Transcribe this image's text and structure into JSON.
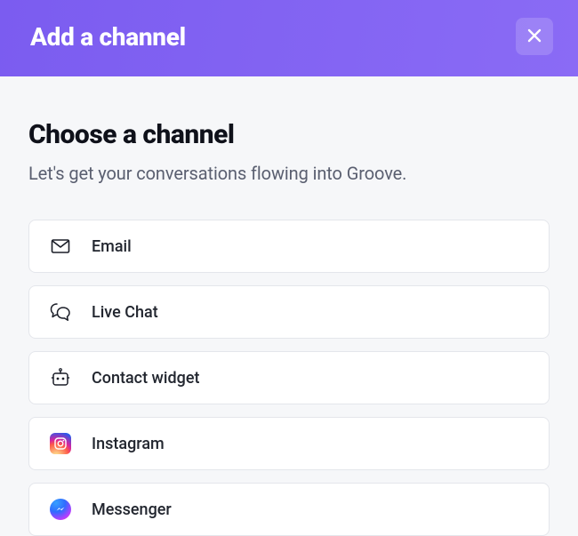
{
  "header": {
    "title": "Add a channel"
  },
  "section": {
    "title": "Choose a channel",
    "subtitle": "Let's get your conversations flowing into Groove."
  },
  "channels": [
    {
      "key": "email",
      "label": "Email",
      "icon": "email-icon"
    },
    {
      "key": "live-chat",
      "label": "Live Chat",
      "icon": "chat-icon"
    },
    {
      "key": "contact-widget",
      "label": "Contact widget",
      "icon": "widget-icon"
    },
    {
      "key": "instagram",
      "label": "Instagram",
      "icon": "instagram-icon"
    },
    {
      "key": "messenger",
      "label": "Messenger",
      "icon": "messenger-icon"
    }
  ]
}
